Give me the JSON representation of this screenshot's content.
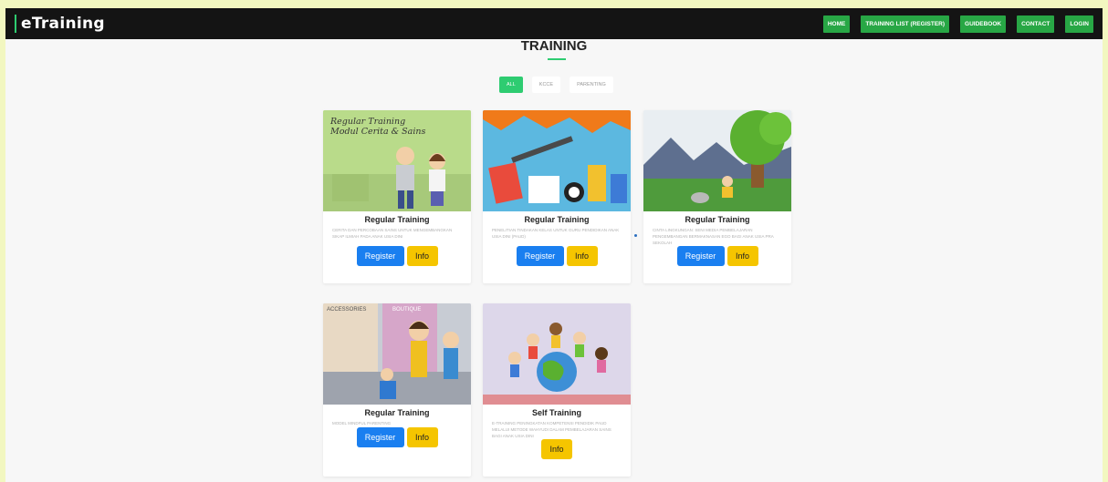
{
  "navbar": {
    "brand": "eTraining",
    "links": [
      "HOME",
      "TRAINING LIST (REGISTER)",
      "GUIDEBOOK",
      "CONTACT",
      "LOGIN"
    ]
  },
  "page": {
    "title": "TRAINING",
    "filters": [
      "ALL",
      "KCCE",
      "PARENTING"
    ]
  },
  "cards": [
    {
      "image_caption": [
        "Regular Training",
        "Modul Cerita & Sains"
      ],
      "title": "Regular Training",
      "description": "CERITA DAN PERCOBAAN SAINS UNTUK MENGEMBANGKAN SIKAP ILMIAH PADA ANAK USIA DINI",
      "register_label": "Register",
      "info_label": "Info"
    },
    {
      "title": "Regular Training",
      "description": "PENELITIAN TINDAKAN KELAS UNTUK GURU PENDIDIKAN ANAK USIA DINI (PAUD)",
      "register_label": "Register",
      "info_label": "Info"
    },
    {
      "title": "Regular Training",
      "description": "CINTA LINGKUNGAN: SENI MEDIA PEMBELAJARAN PENGEMBANGAN BERMAKNASAN EGO BAGI ANAK USIA PRA SEKOLAH",
      "register_label": "Register",
      "info_label": "Info"
    },
    {
      "title": "Regular Training",
      "description": "MODEL MINDFUL PARENTING",
      "register_label": "Register",
      "info_label": "Info",
      "image_signs": [
        "ACCESSORIES",
        "BOUTIQUE"
      ]
    },
    {
      "title": "Self Training",
      "description": "E-TRAINING PENINGKATAN KOMPETENSI PENDIDIK PAUD MELALUI METODE WAHYUDI DALAM PEMBELAJARAN SAINS BAGI ANAK USIA DINI",
      "info_label": "Info"
    }
  ],
  "colors": {
    "accent_green": "#2ecc71",
    "nav_button": "#28a745",
    "register_blue": "#1a7ff0",
    "info_yellow": "#f5c500",
    "navbar_bg": "#141414"
  }
}
